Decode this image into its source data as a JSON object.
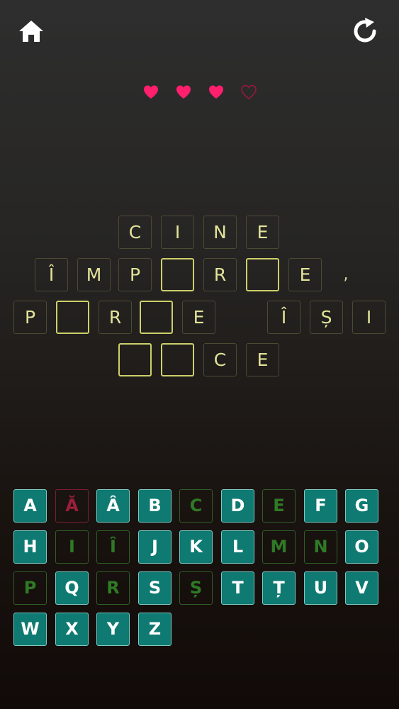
{
  "header": {
    "home_icon": "home-icon",
    "restart_icon": "restart-icon"
  },
  "hearts": {
    "total": 4,
    "remaining": 3,
    "color": "#ff1f6d"
  },
  "puzzle": {
    "rows": [
      [
        {
          "t": "C"
        },
        {
          "t": "I"
        },
        {
          "t": "N"
        },
        {
          "t": "E"
        }
      ],
      [
        {
          "t": "Î"
        },
        {
          "t": "M"
        },
        {
          "t": "P"
        },
        {
          "t": ""
        },
        {
          "t": "R"
        },
        {
          "t": ""
        },
        {
          "t": "E"
        },
        {
          "t": ",",
          "p": true
        }
      ],
      [
        {
          "t": "P"
        },
        {
          "t": ""
        },
        {
          "t": "R"
        },
        {
          "t": ""
        },
        {
          "t": "E"
        },
        {
          "t": "Î"
        },
        {
          "t": "Ș"
        },
        {
          "t": "I"
        }
      ],
      [
        {
          "t": ""
        },
        {
          "t": ""
        },
        {
          "t": "C"
        },
        {
          "t": "E"
        }
      ]
    ]
  },
  "keyboard": {
    "rows": [
      [
        {
          "l": "A",
          "s": "available"
        },
        {
          "l": "Ă",
          "s": "wrong"
        },
        {
          "l": "Â",
          "s": "available"
        },
        {
          "l": "B",
          "s": "available"
        },
        {
          "l": "C",
          "s": "correct"
        },
        {
          "l": "D",
          "s": "available"
        },
        {
          "l": "E",
          "s": "correct"
        },
        {
          "l": "F",
          "s": "available"
        },
        {
          "l": "G",
          "s": "available"
        }
      ],
      [
        {
          "l": "H",
          "s": "available"
        },
        {
          "l": "I",
          "s": "correct"
        },
        {
          "l": "Î",
          "s": "correct"
        },
        {
          "l": "J",
          "s": "available"
        },
        {
          "l": "K",
          "s": "available"
        },
        {
          "l": "L",
          "s": "available"
        },
        {
          "l": "M",
          "s": "correct"
        },
        {
          "l": "N",
          "s": "correct"
        },
        {
          "l": "O",
          "s": "available"
        }
      ],
      [
        {
          "l": "P",
          "s": "correct"
        },
        {
          "l": "Q",
          "s": "available"
        },
        {
          "l": "R",
          "s": "correct"
        },
        {
          "l": "S",
          "s": "available"
        },
        {
          "l": "Ș",
          "s": "correct"
        },
        {
          "l": "T",
          "s": "available"
        },
        {
          "l": "Ț",
          "s": "available"
        },
        {
          "l": "U",
          "s": "available"
        },
        {
          "l": "V",
          "s": "available"
        }
      ],
      [
        {
          "l": "W",
          "s": "available"
        },
        {
          "l": "X",
          "s": "available"
        },
        {
          "l": "Y",
          "s": "available"
        },
        {
          "l": "Z",
          "s": "available"
        }
      ]
    ]
  }
}
